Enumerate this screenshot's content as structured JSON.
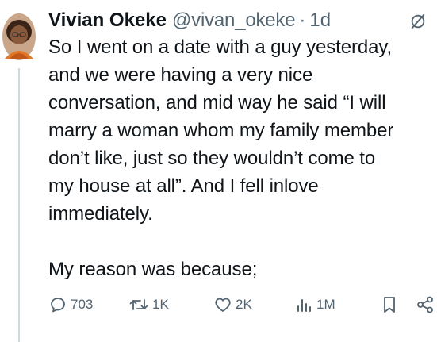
{
  "tweet": {
    "author_name": "Vivian Okeke",
    "author_handle": "@vivan_okeke",
    "separator": "·",
    "time": "1d",
    "text": "So I went on a date with a guy yesterday,\nand we were having a very nice\nconversation, and mid way he said “I will\nmarry a woman whom my family member\ndon’t like, just so they wouldn’t come to\nmy house at all”.   And I fell inlove\nimmediately.\n\nMy reason was because;"
  },
  "actions": {
    "replies": "703",
    "reposts": "1K",
    "likes": "2K",
    "views": "1M"
  },
  "icons": {
    "avatar": "avatar",
    "grok": "grok-icon",
    "reply": "reply-icon",
    "repost": "repost-icon",
    "like": "heart-icon",
    "views": "views-icon",
    "bookmark": "bookmark-icon",
    "share": "share-icon"
  },
  "colors": {
    "text": "#0f1419",
    "muted": "#536471",
    "thread_line": "#cfd9de",
    "avatar_bg": "#c9a58a"
  }
}
